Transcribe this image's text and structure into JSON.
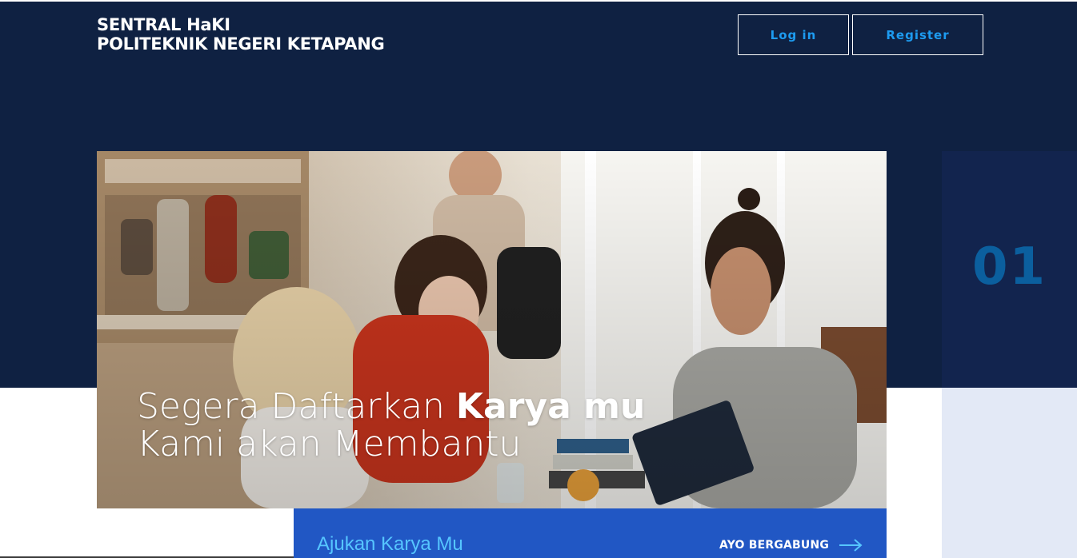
{
  "header": {
    "brand_line1": "SENTRAL HaKI",
    "brand_line2": "POLITEKNIK NEGERI KETAPANG",
    "login_label": "Log in",
    "register_label": "Register"
  },
  "hero": {
    "line1_regular": "Segera Daftarkan ",
    "line1_bold": "Karya mu",
    "line2": "Kami akan Membantu",
    "image_icon": "students-studying-photo"
  },
  "side": {
    "number": "01"
  },
  "cta": {
    "left_text": "Ajukan Karya Mu",
    "right_text": "AYO BERGABUNG",
    "arrow_icon": "arrow-right-icon"
  },
  "colors": {
    "header_bg": "#0f2142",
    "button_text": "#1d9bf0",
    "number": "#0b5f9e",
    "cta_bg": "#2157c4",
    "cta_left_text": "#56c6ff"
  }
}
